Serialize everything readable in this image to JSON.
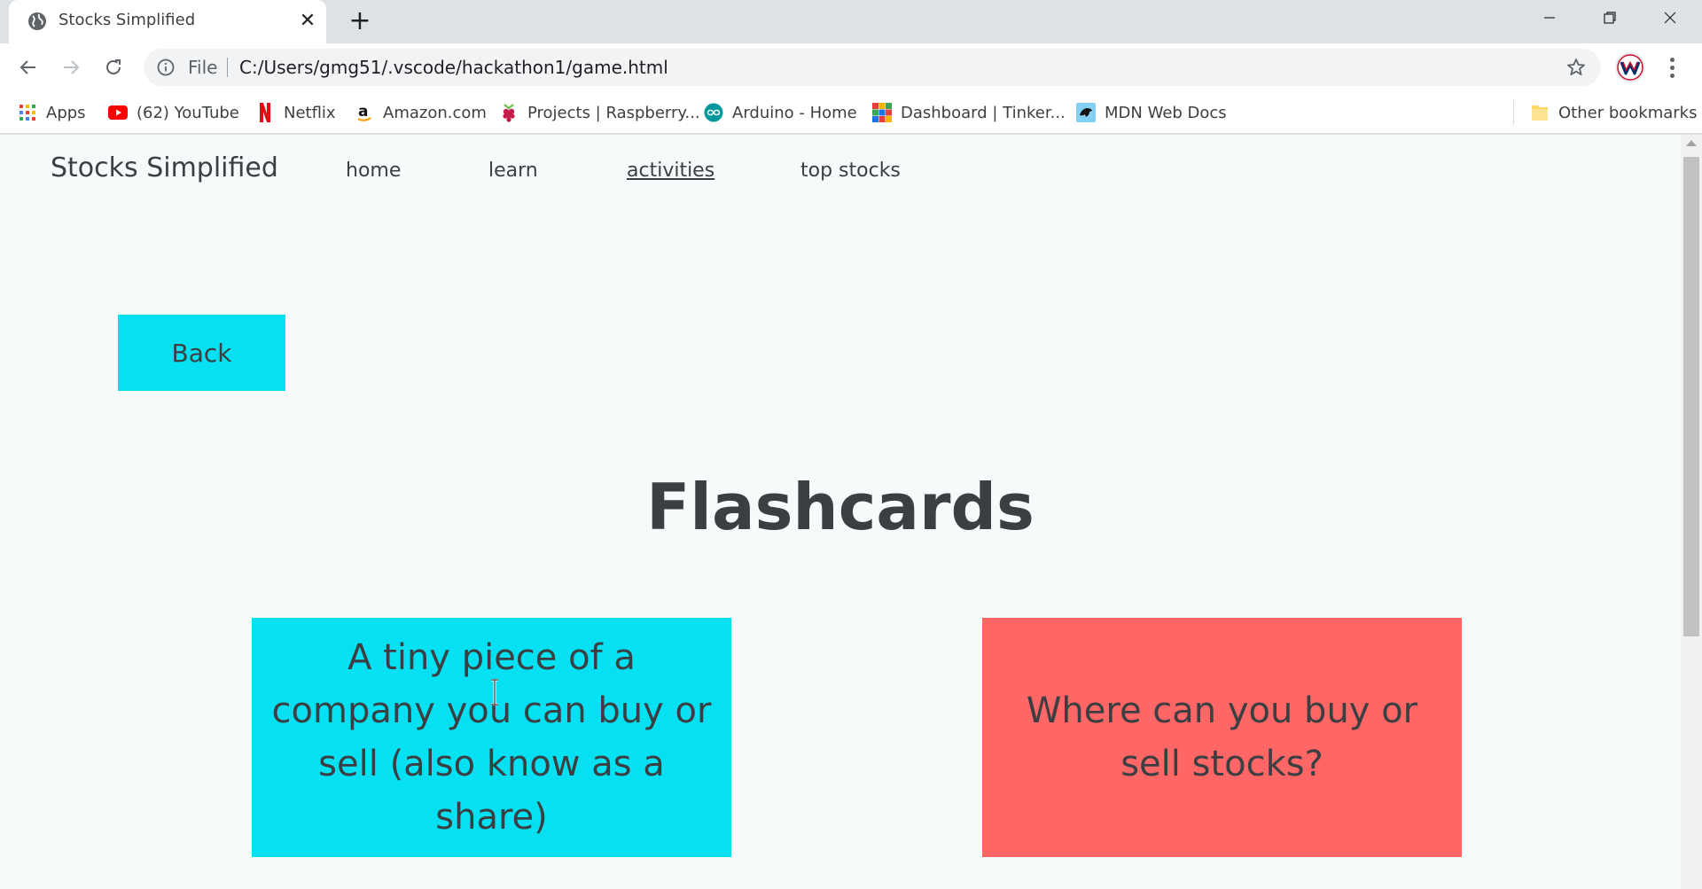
{
  "browser": {
    "tab": {
      "title": "Stocks Simplified",
      "favicon": "globe-icon",
      "close": "✕"
    },
    "new_tab": "+",
    "toolbar": {
      "scheme_label": "File",
      "url": "C:/Users/gmg51/.vscode/hackathon1/game.html"
    },
    "bookmarks": [
      {
        "label": "Apps",
        "icon": "apps-grid-icon"
      },
      {
        "label": "(62) YouTube",
        "icon": "youtube-icon"
      },
      {
        "label": "Netflix",
        "icon": "netflix-icon"
      },
      {
        "label": "Amazon.com",
        "icon": "amazon-icon"
      },
      {
        "label": "Projects | Raspberry...",
        "icon": "raspberry-pi-icon"
      },
      {
        "label": "Arduino - Home",
        "icon": "arduino-icon"
      },
      {
        "label": "Dashboard | Tinker...",
        "icon": "tinkercad-icon"
      },
      {
        "label": "MDN Web Docs",
        "icon": "mdn-icon"
      }
    ],
    "other_bookmarks": "Other bookmarks"
  },
  "page": {
    "brand": "Stocks Simplified",
    "nav": [
      {
        "label": "home",
        "active": false
      },
      {
        "label": "learn",
        "active": false
      },
      {
        "label": "activities",
        "active": true
      },
      {
        "label": "top stocks",
        "active": false
      }
    ],
    "back_label": "Back",
    "heading": "Flashcards",
    "cards": [
      {
        "text": "A tiny piece of a company you can buy or sell (also know as a share)",
        "color": "#05e1f2"
      },
      {
        "text": "Where can you buy or sell stocks?",
        "color": "#ff6666"
      }
    ]
  },
  "colors": {
    "accent_cyan": "#05e1f2",
    "accent_red": "#ff6666",
    "page_bg": "#f7fafa",
    "text": "#3b3f42"
  }
}
